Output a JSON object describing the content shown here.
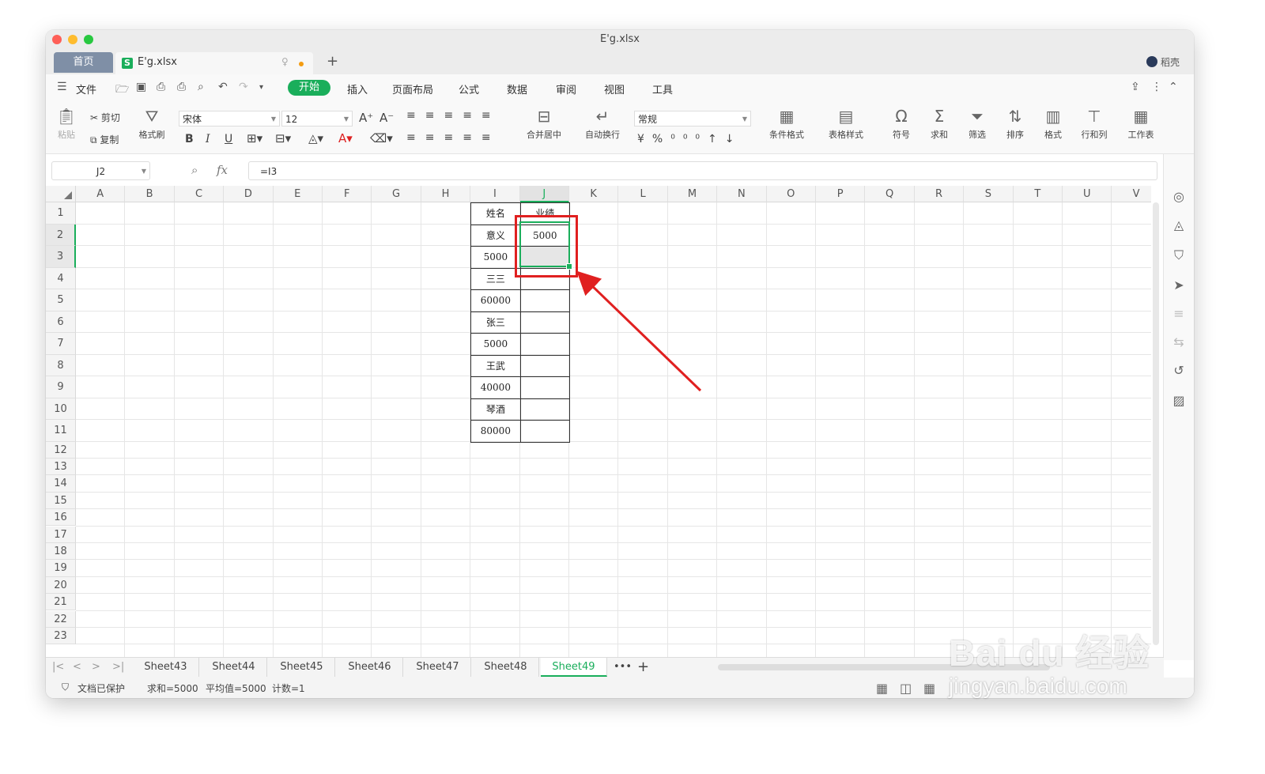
{
  "window": {
    "title": "E'g.xlsx"
  },
  "tabs": {
    "home": "首页",
    "file_icon": "S",
    "file_name": "E'g.xlsx",
    "add": "+"
  },
  "user": {
    "name": "稻壳"
  },
  "menu": {
    "file": "文件",
    "items": [
      "开始",
      "插入",
      "页面布局",
      "公式",
      "数据",
      "审阅",
      "视图",
      "工具"
    ]
  },
  "ribbon": {
    "paste": "粘贴",
    "cut": "剪切",
    "copy": "复制",
    "format_painter": "格式刷",
    "font_name": "宋体",
    "font_size": "12",
    "merge_center": "合并居中",
    "wrap_text": "自动换行",
    "number_format": "常规",
    "conditional_format": "条件格式",
    "table_style": "表格样式",
    "symbol": "符号",
    "sum": "求和",
    "filter": "筛选",
    "sort": "排序",
    "format": "格式",
    "row_col": "行和列",
    "worksheet": "工作表"
  },
  "formula_bar": {
    "cell_ref": "J2",
    "fx": "fx",
    "formula": "=I3"
  },
  "columns": [
    "A",
    "B",
    "C",
    "D",
    "E",
    "F",
    "G",
    "H",
    "I",
    "J",
    "K",
    "L",
    "M",
    "N",
    "O",
    "P",
    "Q",
    "R",
    "S",
    "T",
    "U",
    "V"
  ],
  "rows": [
    "1",
    "2",
    "3",
    "4",
    "5",
    "6",
    "7",
    "8",
    "9",
    "10",
    "11",
    "12",
    "13",
    "14",
    "15",
    "16",
    "17",
    "18",
    "19",
    "20",
    "21",
    "22",
    "23"
  ],
  "cells": {
    "I": [
      "姓名",
      "意义",
      "5000",
      "三三",
      "60000",
      "张三",
      "5000",
      "王武",
      "40000",
      "琴酒",
      "80000"
    ],
    "J": [
      "业绩",
      "5000",
      "",
      "",
      "",
      "",
      "",
      "",
      "",
      "",
      ""
    ]
  },
  "sheets": [
    "Sheet43",
    "Sheet44",
    "Sheet45",
    "Sheet46",
    "Sheet47",
    "Sheet48",
    "Sheet49"
  ],
  "active_sheet": "Sheet49",
  "sheet_more": "•••",
  "status": {
    "protected": "文档已保护",
    "sum": "求和=5000",
    "avg": "平均值=5000",
    "count": "计数=1"
  },
  "watermark": {
    "main": "Bai du 经验",
    "sub": "jingyan.baidu.com"
  },
  "colors": {
    "accent": "#1aae5b",
    "annotation": "#e02020"
  }
}
